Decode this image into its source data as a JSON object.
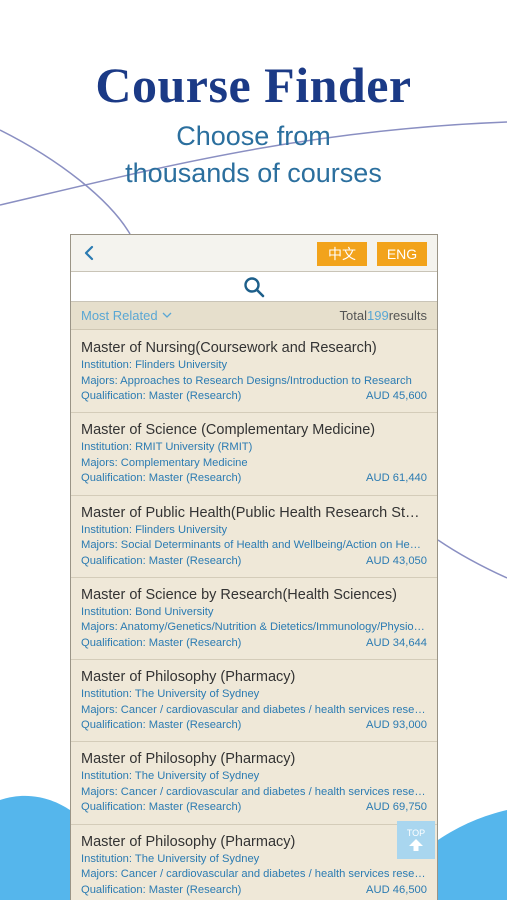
{
  "promo": {
    "headline": "Course Finder",
    "subline1": "Choose from",
    "subline2": "thousands of courses"
  },
  "header": {
    "back_icon": "chevron-left-icon",
    "lang_zh": "中文",
    "lang_en": "ENG"
  },
  "search": {
    "icon": "search-icon"
  },
  "sort": {
    "label": "Most Related",
    "total_prefix": "Total",
    "total_count": "199",
    "total_suffix": "results"
  },
  "courses": [
    {
      "title": "Master of Nursing(Coursework and Research)",
      "institution": "Institution: Flinders University",
      "majors": "Majors: Approaches to Research Designs/Introduction to Research",
      "qualification": "Qualification: Master (Research)",
      "fee": "AUD 45,600"
    },
    {
      "title": "Master of Science (Complementary Medicine)",
      "institution": "Institution: RMIT University (RMIT)",
      "majors": "Majors: Complementary Medicine",
      "qualification": "Qualification: Master (Research)",
      "fee": "AUD 61,440"
    },
    {
      "title": "Master of Public Health(Public Health Research Stream)",
      "institution": "Institution: Flinders University",
      "majors": "Majors: Social Determinants of Health and Wellbeing/Action on Health",
      "qualification": "Qualification: Master (Research)",
      "fee": "AUD 43,050"
    },
    {
      "title": "Master of Science by Research(Health Sciences)",
      "institution": "Institution: Bond University",
      "majors": "Majors: Anatomy/Genetics/Nutrition & Dietetics/Immunology/Physiology",
      "qualification": "Qualification: Master (Research)",
      "fee": "AUD 34,644"
    },
    {
      "title": "Master of Philosophy (Pharmacy)",
      "institution": "Institution: The University of Sydney",
      "majors": "Majors: Cancer / cardiovascular and diabetes / health services research",
      "qualification": "Qualification: Master (Research)",
      "fee": "AUD 93,000"
    },
    {
      "title": "Master of Philosophy (Pharmacy)",
      "institution": "Institution: The University of Sydney",
      "majors": "Majors: Cancer / cardiovascular and diabetes / health services research",
      "qualification": "Qualification: Master (Research)",
      "fee": "AUD 69,750"
    },
    {
      "title": "Master of Philosophy (Pharmacy)",
      "institution": "Institution: The University of Sydney",
      "majors": "Majors: Cancer / cardiovascular and diabetes / health services research",
      "qualification": "Qualification: Master (Research)",
      "fee": "AUD 46,500"
    }
  ],
  "top_button": {
    "label": "TOP",
    "icon": "arrow-up-icon"
  },
  "colors": {
    "accent_orange": "#f2a31b",
    "link_blue": "#2b7bb2",
    "headline_navy": "#1b3a86",
    "list_bg": "#efe8d8"
  }
}
